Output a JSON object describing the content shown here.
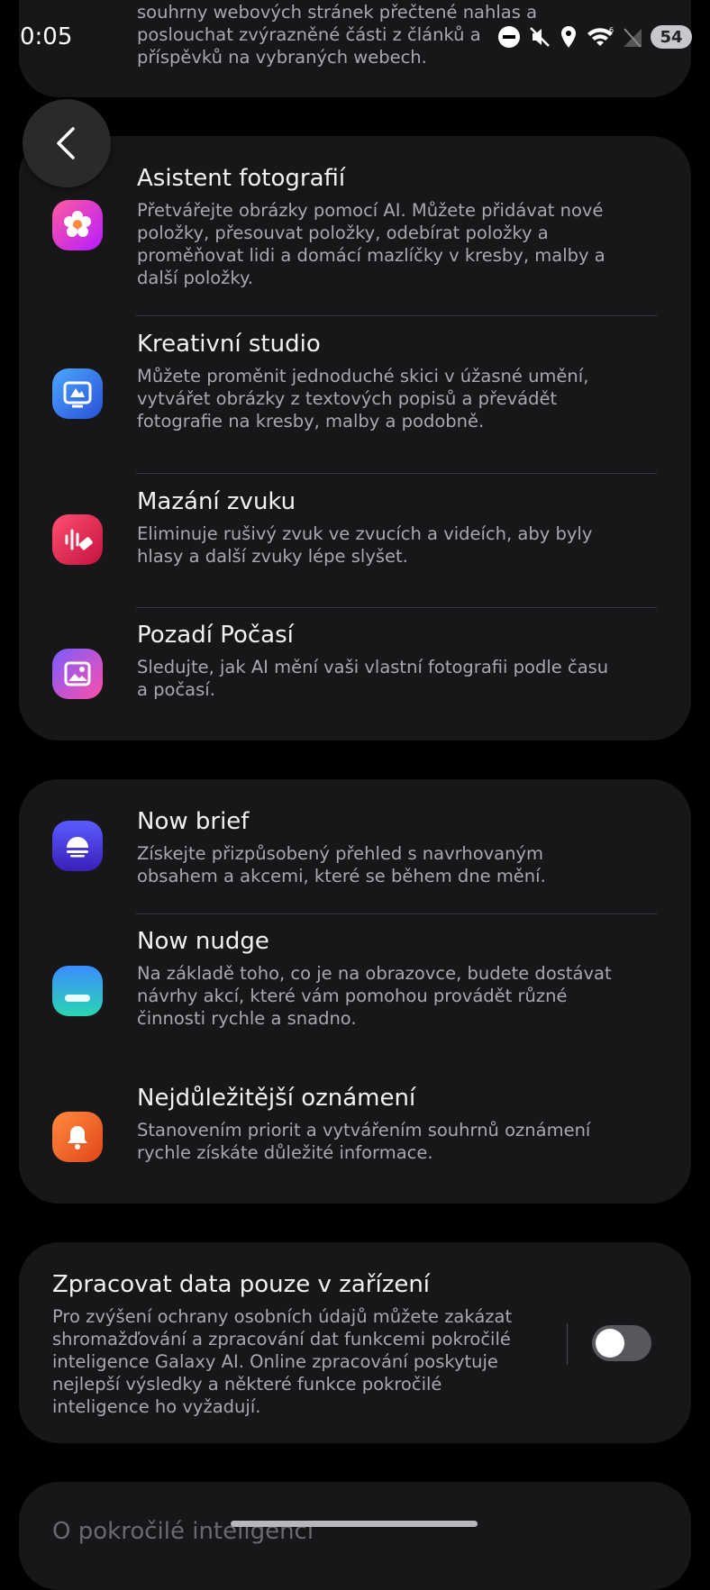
{
  "status_bar": {
    "time": "0:05",
    "battery": "54"
  },
  "top_card": {
    "description": "souhrny webových stránek přečtené nahlas a poslouchat zvýrazněné části z článků a příspěvků na vybraných webech."
  },
  "group1": [
    {
      "title": "Asistent fotografií",
      "description": "Přetvářejte obrázky pomocí AI. Můžete přidávat nové položky, přesouvat položky, odebírat položky a proměňovat lidi a domácí mazlíčky v kresby, malby a další položky.",
      "icon": "photo-assist-icon"
    },
    {
      "title": "Kreativní studio",
      "description": "Můžete proměnit jednoduché skici v úžasné umění, vytvářet obrázky z textových popisů a převádět fotografie na kresby, malby a podobně.",
      "icon": "creative-studio-icon"
    },
    {
      "title": "Mazání zvuku",
      "description": "Eliminuje rušivý zvuk ve zvucích a videích, aby byly hlasy a další zvuky lépe slyšet.",
      "icon": "audio-eraser-icon"
    },
    {
      "title": "Pozadí Počasí",
      "description": "Sledujte, jak AI mění vaši vlastní fotografii podle času a počasí.",
      "icon": "weather-wallpaper-icon"
    }
  ],
  "group2": [
    {
      "title": "Now brief",
      "description": "Získejte přizpůsobený přehled s navrhovaným obsahem a akcemi, které se během dne mění.",
      "icon": "now-brief-icon"
    },
    {
      "title": "Now nudge",
      "description": "Na základě toho, co je na obrazovce, budete dostávat návrhy akcí, které vám pomohou provádět různé činnosti rychle a snadno.",
      "icon": "now-nudge-icon"
    },
    {
      "title": "Nejdůležitější oznámení",
      "description": "Stanovením priorit a vytvářením souhrnů oznámení rychle získáte důležité informace.",
      "icon": "notification-bell-icon"
    }
  ],
  "on_device": {
    "title": "Zpracovat data pouze v zařízení",
    "description": "Pro zvýšení ochrany osobních údajů můžete zakázat shromažďování a zpracování dat funkcemi pokročilé inteligence Galaxy AI. Online zpracování poskytuje nejlepší výsledky a některé funkce pokročilé inteligence ho vyžadují.",
    "toggle_on": false
  },
  "bottom_card": {
    "title": "O pokročilé inteligenci"
  },
  "colors": {
    "background": "#000000",
    "card": "#171719",
    "secondary_text": "#a9a9ad"
  }
}
